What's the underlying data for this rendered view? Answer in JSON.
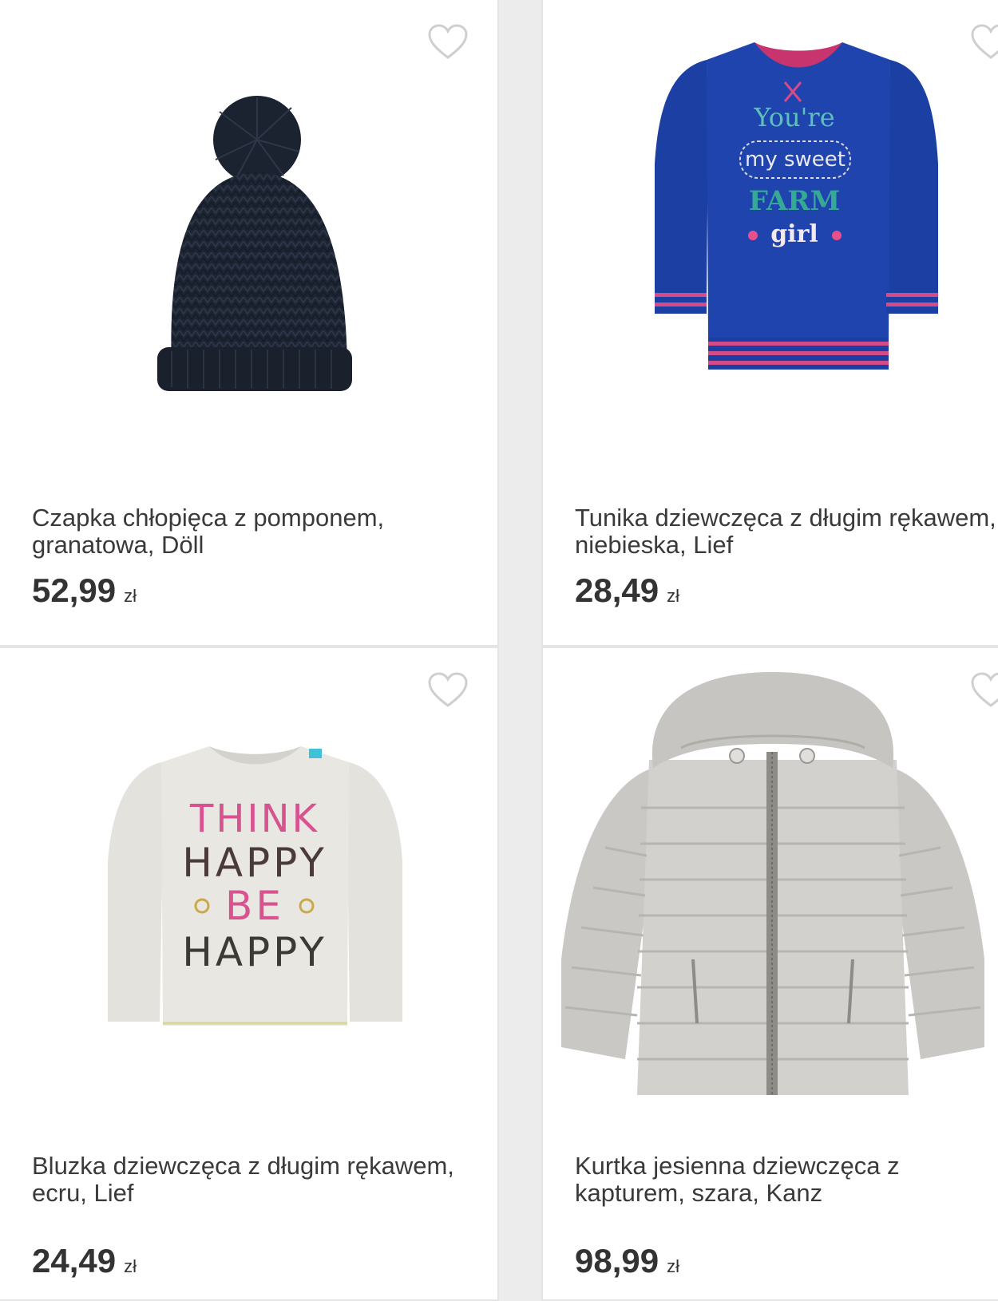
{
  "colors": {
    "background": "#ececec",
    "card": "#ffffff",
    "text": "#3a3a3a",
    "heart_outline": "#cfcfcf"
  },
  "products": [
    {
      "title": "Czapka chłopięca z pomponem, granatowa, Döll",
      "price": "52,99",
      "currency": "zł",
      "image_icon": "beanie-hat-image",
      "favorite_icon": "heart-outline-icon"
    },
    {
      "title": "Tunika dziewczęca z długim rękawem, niebieska, Lief",
      "price": "28,49",
      "currency": "zł",
      "image_icon": "blue-sweatshirt-image",
      "favorite_icon": "heart-outline-icon",
      "print_text": [
        "You're",
        "my sweet",
        "FARM",
        "girl"
      ]
    },
    {
      "title": "Bluzka dziewczęca z długim rękawem, ecru, Lief",
      "price": "24,49",
      "currency": "zł",
      "image_icon": "ecru-shirt-image",
      "favorite_icon": "heart-outline-icon",
      "print_text": [
        "THINK",
        "HAPPY",
        "BE",
        "HAPPY"
      ]
    },
    {
      "title": "Kurtka jesienna dziewczęca z kapturem, szara, Kanz",
      "price": "98,99",
      "currency": "zł",
      "image_icon": "grey-puffer-jacket-image",
      "favorite_icon": "heart-outline-icon"
    }
  ]
}
